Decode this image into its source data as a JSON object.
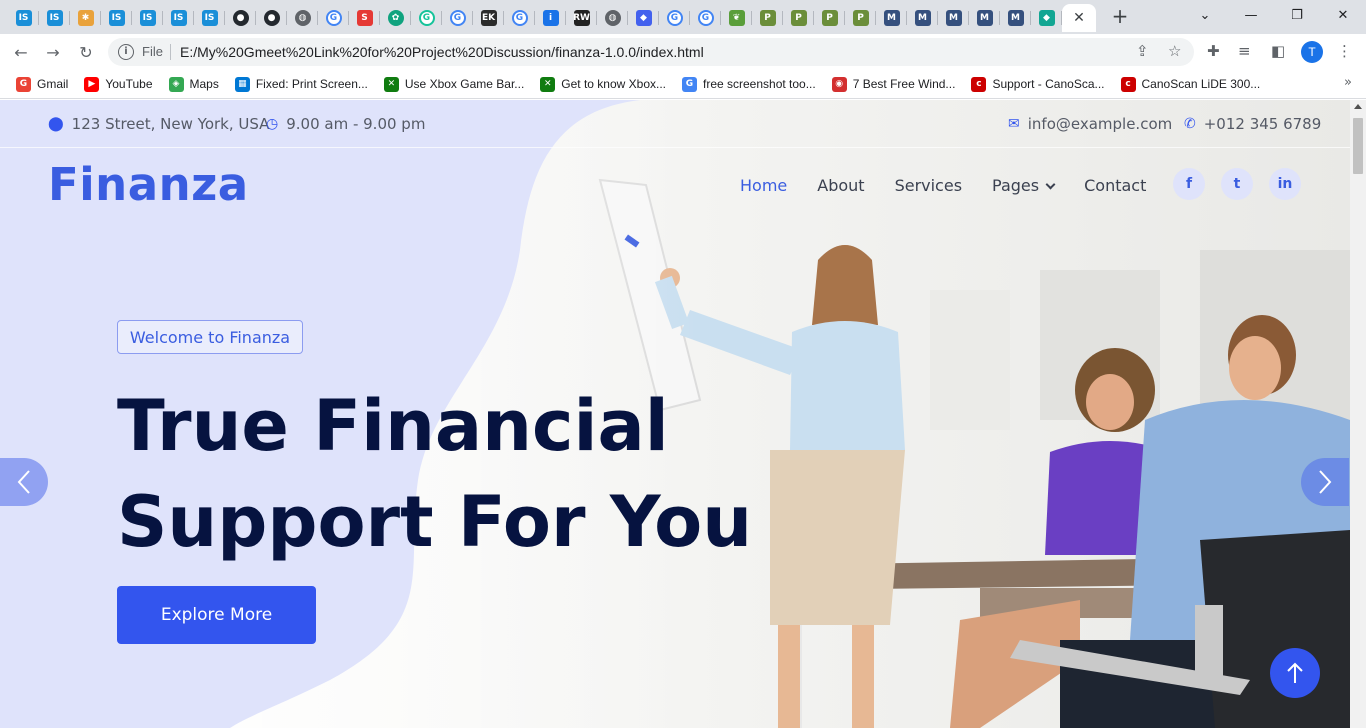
{
  "browser": {
    "tabs": [
      {
        "icon": "is-icon",
        "glyph": "IS",
        "color": "#1a8fd8"
      },
      {
        "icon": "is-icon",
        "glyph": "IS",
        "color": "#1a8fd8"
      },
      {
        "icon": "pinwheel-icon",
        "glyph": "✱",
        "color": "#e9a23b"
      },
      {
        "icon": "is-icon",
        "glyph": "IS",
        "color": "#1a8fd8"
      },
      {
        "icon": "is-icon",
        "glyph": "IS",
        "color": "#1a8fd8"
      },
      {
        "icon": "is-icon",
        "glyph": "IS",
        "color": "#1a8fd8"
      },
      {
        "icon": "is-icon",
        "glyph": "IS",
        "color": "#1a8fd8"
      },
      {
        "icon": "github-icon",
        "glyph": "●",
        "color": "#24292f"
      },
      {
        "icon": "github-icon",
        "glyph": "●",
        "color": "#24292f"
      },
      {
        "icon": "globe-icon",
        "glyph": "◍",
        "color": "#5f6368"
      },
      {
        "icon": "google-icon",
        "glyph": "G",
        "color": "#4285f4"
      },
      {
        "icon": "s-icon",
        "glyph": "S",
        "color": "#e53935"
      },
      {
        "icon": "openai-icon",
        "glyph": "✿",
        "color": "#10a37f"
      },
      {
        "icon": "grammarly-icon",
        "glyph": "G",
        "color": "#15c39a"
      },
      {
        "icon": "google-icon",
        "glyph": "G",
        "color": "#4285f4"
      },
      {
        "icon": "ek-icon",
        "glyph": "EK",
        "color": "#2b2b2b"
      },
      {
        "icon": "google-icon",
        "glyph": "G",
        "color": "#4285f4"
      },
      {
        "icon": "info-icon",
        "glyph": "i",
        "color": "#1a73e8"
      },
      {
        "icon": "rw-icon",
        "glyph": "RW",
        "color": "#222222"
      },
      {
        "icon": "globe-icon",
        "glyph": "◍",
        "color": "#5f6368"
      },
      {
        "icon": "cube-icon",
        "glyph": "◆",
        "color": "#4361ee"
      },
      {
        "icon": "google-icon",
        "glyph": "G",
        "color": "#4285f4"
      },
      {
        "icon": "google-icon",
        "glyph": "G",
        "color": "#4285f4"
      },
      {
        "icon": "leaf-icon",
        "glyph": "❦",
        "color": "#5a9e3a"
      },
      {
        "icon": "p-icon",
        "glyph": "P",
        "color": "#6b8e3a"
      },
      {
        "icon": "p-icon",
        "glyph": "P",
        "color": "#6b8e3a"
      },
      {
        "icon": "p-icon",
        "glyph": "P",
        "color": "#6b8e3a"
      },
      {
        "icon": "p-icon",
        "glyph": "P",
        "color": "#6b8e3a"
      },
      {
        "icon": "m-icon",
        "glyph": "M",
        "color": "#35507e"
      },
      {
        "icon": "m-icon",
        "glyph": "M",
        "color": "#35507e"
      },
      {
        "icon": "m-icon",
        "glyph": "M",
        "color": "#35507e"
      },
      {
        "icon": "m-icon",
        "glyph": "M",
        "color": "#35507e"
      },
      {
        "icon": "m-icon",
        "glyph": "M",
        "color": "#35507e"
      },
      {
        "icon": "diamond-icon",
        "glyph": "◆",
        "color": "#12a693"
      }
    ],
    "active_tab_close": "✕",
    "new_tab": "+",
    "address": {
      "scheme": "File",
      "url": "E:/My%20Gmeet%20Link%20for%20Project%20Discussion/finanza-1.0.0/index.html"
    },
    "profile_initial": "T",
    "bookmarks": [
      {
        "label": "Gmail",
        "icon": "google-icon",
        "glyph": "G",
        "color": "#ea4335"
      },
      {
        "label": "YouTube",
        "icon": "youtube-icon",
        "glyph": "▶",
        "color": "#ff0000"
      },
      {
        "label": "Maps",
        "icon": "maps-icon",
        "glyph": "◈",
        "color": "#34a853"
      },
      {
        "label": "Fixed: Print Screen...",
        "icon": "windows-icon",
        "glyph": "▦",
        "color": "#0078d4"
      },
      {
        "label": "Use Xbox Game Bar...",
        "icon": "xbox-icon",
        "glyph": "✕",
        "color": "#107c10"
      },
      {
        "label": "Get to know Xbox...",
        "icon": "xbox-icon",
        "glyph": "✕",
        "color": "#107c10"
      },
      {
        "label": "free screenshot too...",
        "icon": "google-icon",
        "glyph": "G",
        "color": "#4285f4"
      },
      {
        "label": "7 Best Free Wind...",
        "icon": "trophy-icon",
        "glyph": "◉",
        "color": "#d32f2f"
      },
      {
        "label": "Support - CanoSca...",
        "icon": "canon-icon",
        "glyph": "c",
        "color": "#cc0000"
      },
      {
        "label": "CanoScan LiDE 300...",
        "icon": "canon-icon",
        "glyph": "c",
        "color": "#cc0000"
      }
    ],
    "bookmarks_more": "»"
  },
  "site": {
    "topbar": {
      "address": "123 Street, New York, USA",
      "hours": "9.00 am - 9.00 pm",
      "email": "info@example.com",
      "phone": "+012 345 6789"
    },
    "logo": "Finanza",
    "nav": [
      {
        "label": "Home",
        "active": true
      },
      {
        "label": "About"
      },
      {
        "label": "Services"
      },
      {
        "label": "Pages",
        "dropdown": true
      },
      {
        "label": "Contact"
      }
    ],
    "social": [
      {
        "name": "facebook-icon",
        "glyph": "f"
      },
      {
        "name": "twitter-icon",
        "glyph": "t"
      },
      {
        "name": "linkedin-icon",
        "glyph": "in"
      }
    ],
    "hero": {
      "welcome": "Welcome to Finanza",
      "headline_line1": "True Financial",
      "headline_line2": "Support For You",
      "cta": "Explore More"
    }
  },
  "colors": {
    "accent": "#3355ee",
    "logo": "#3a5de0",
    "headline": "#061340",
    "blob": "#dfe3fb"
  }
}
